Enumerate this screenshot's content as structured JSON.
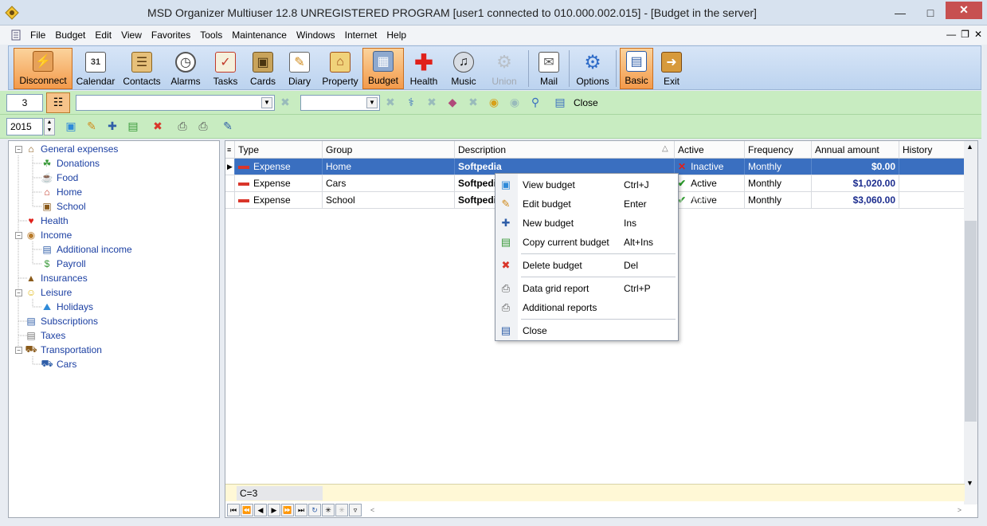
{
  "window": {
    "title": "MSD Organizer Multiuser 12.8 UNREGISTERED PROGRAM [user1 connected to 010.000.002.015] - [Budget in the server]"
  },
  "menu": [
    "File",
    "Budget",
    "Edit",
    "View",
    "Favorites",
    "Tools",
    "Maintenance",
    "Windows",
    "Internet",
    "Help"
  ],
  "toolbar": {
    "buttons": [
      "Disconnect",
      "Calendar",
      "Contacts",
      "Alarms",
      "Tasks",
      "Cards",
      "Diary",
      "Property",
      "Budget",
      "Health",
      "Music",
      "Union",
      "Mail",
      "Options",
      "Basic",
      "Exit"
    ]
  },
  "filter_bar": {
    "count_value": "3",
    "close_label": "Close"
  },
  "year_bar": {
    "year_value": "2015"
  },
  "tree": {
    "items": [
      "General expenses",
      "Donations",
      "Food",
      "Home",
      "School",
      "Health",
      "Income",
      "Additional income",
      "Payroll",
      "Insurances",
      "Leisure",
      "Holidays",
      "Subscriptions",
      "Taxes",
      "Transportation",
      "Cars"
    ]
  },
  "grid": {
    "columns": [
      "Type",
      "Group",
      "Description",
      "Active",
      "Frequency",
      "Annual amount",
      "History"
    ],
    "rows": [
      {
        "type": "Expense",
        "group": "Home",
        "description": "Softpedia",
        "active": "Inactive",
        "frequency": "Monthly",
        "amount": "$0.00"
      },
      {
        "type": "Expense",
        "group": "Cars",
        "description": "Softpedia",
        "active": "Active",
        "frequency": "Monthly",
        "amount": "$1,020.00"
      },
      {
        "type": "Expense",
        "group": "School",
        "description": "Softpedia",
        "active": "Active",
        "frequency": "Monthly",
        "amount": "$3,060.00"
      }
    ],
    "footer_count": "C=3"
  },
  "context_menu": {
    "items": [
      {
        "label": "View budget",
        "shortcut": "Ctrl+J"
      },
      {
        "label": "Edit budget",
        "shortcut": "Enter"
      },
      {
        "label": "New budget",
        "shortcut": "Ins"
      },
      {
        "label": "Copy current budget",
        "shortcut": "Alt+Ins"
      },
      {
        "label": "Delete budget",
        "shortcut": "Del"
      },
      {
        "label": "Data grid report",
        "shortcut": "Ctrl+P"
      },
      {
        "label": "Additional reports",
        "shortcut": ""
      },
      {
        "label": "Close",
        "shortcut": ""
      }
    ]
  },
  "colors": {
    "accent": "#3a6fc0",
    "active_tool": "#f39a4b",
    "green_bar": "#c8ecc1",
    "amount_text": "#1b2c8e"
  }
}
